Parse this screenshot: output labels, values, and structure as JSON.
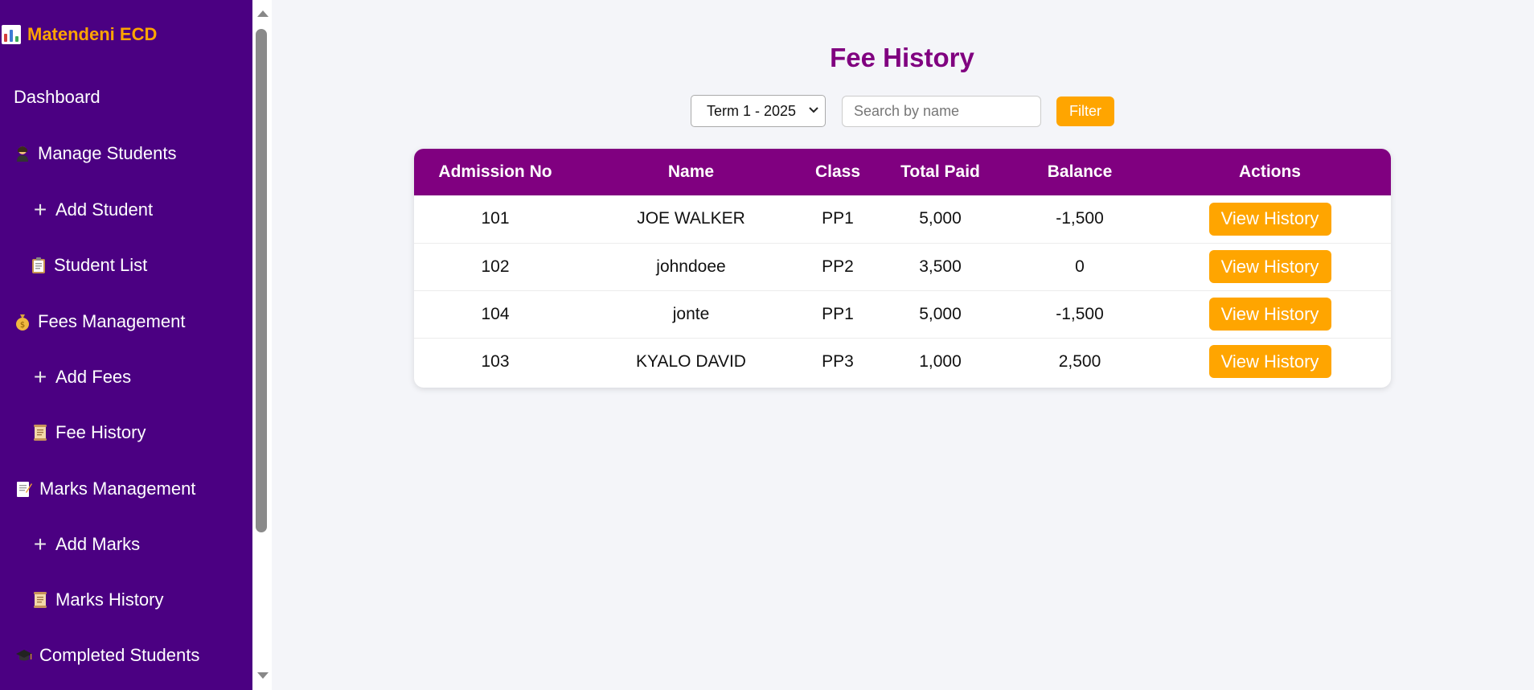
{
  "sidebar": {
    "brand": "Matendeni ECD",
    "items": [
      {
        "label": "Dashboard",
        "icon": ""
      },
      {
        "label": "Manage Students",
        "icon": "student-icon"
      },
      {
        "label": "Add Student",
        "icon": "plus-icon"
      },
      {
        "label": "Student List",
        "icon": "clipboard-icon"
      },
      {
        "label": "Fees Management",
        "icon": "money-bag-icon"
      },
      {
        "label": "Add Fees",
        "icon": "plus-icon"
      },
      {
        "label": "Fee History",
        "icon": "scroll-icon"
      },
      {
        "label": "Marks Management",
        "icon": "memo-icon"
      },
      {
        "label": "Add Marks",
        "icon": "plus-icon"
      },
      {
        "label": "Marks History",
        "icon": "scroll-icon"
      },
      {
        "label": "Completed Students",
        "icon": "graduation-cap-icon"
      }
    ]
  },
  "main": {
    "title": "Fee History",
    "filters": {
      "term_selected": "Term 1 - 2025",
      "search_placeholder": "Search by name",
      "filter_label": "Filter"
    },
    "table": {
      "headers": [
        "Admission No",
        "Name",
        "Class",
        "Total Paid",
        "Balance",
        "Actions"
      ],
      "rows": [
        {
          "admission_no": "101",
          "name": "JOE WALKER",
          "class": "PP1",
          "total_paid": "5,000",
          "balance": "-1,500",
          "action": "View History"
        },
        {
          "admission_no": "102",
          "name": "johndoee",
          "class": "PP2",
          "total_paid": "3,500",
          "balance": "0",
          "action": "View History"
        },
        {
          "admission_no": "104",
          "name": "jonte",
          "class": "PP1",
          "total_paid": "5,000",
          "balance": "-1,500",
          "action": "View History"
        },
        {
          "admission_no": "103",
          "name": "KYALO DAVID",
          "class": "PP3",
          "total_paid": "1,000",
          "balance": "2,500",
          "action": "View History"
        }
      ]
    }
  },
  "colors": {
    "sidebar_bg": "#4b0082",
    "accent": "#ffa500",
    "header_bg": "#800080",
    "title": "#800080"
  }
}
